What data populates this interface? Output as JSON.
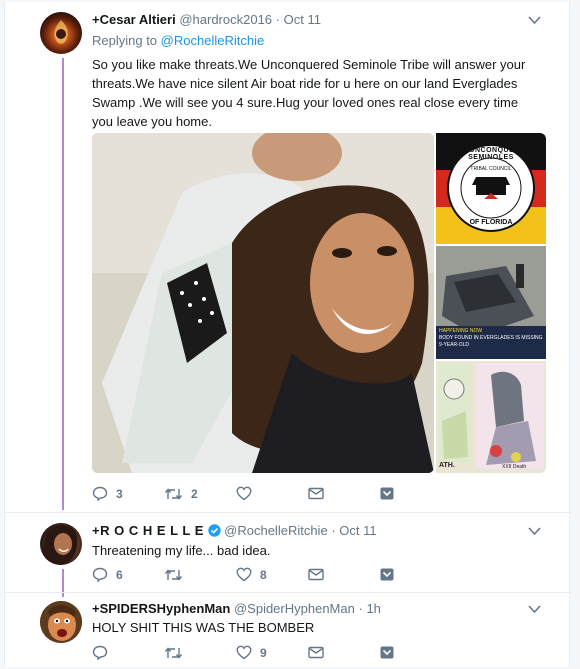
{
  "tweets": [
    {
      "name": "+Cesar Altieri",
      "handle": "@hardrock2016",
      "dot": "·",
      "time": "Oct 11",
      "replying_prefix": "Replying to",
      "replying_to": "@RochelleRitchie",
      "text": "So you like make threats.We Unconquered Seminole Tribe will answer your threats.We have nice silent Air boat ride for u here on our land Everglades Swamp .We will see you 4 sure.Hug your loved ones real close every time you leave you home.",
      "media": {
        "seal_top_text": "THE UNCONQUERED SEMINOLES",
        "seal_mid_text": "TRIBAL COUNCIL",
        "seal_bottom_text": "OF FLORIDA",
        "news_caption_1": "HAPPENING NOW",
        "news_caption_2": "BODY FOUND IN EVERGLADES IS MISSING",
        "news_caption_3": "9-YEAR-OLD",
        "collage_caption_left": "ATH.",
        "collage_caption_right": "XXII Death"
      },
      "replies": "3",
      "retweets": "2",
      "likes": ""
    },
    {
      "name": "+R O C H E L L E",
      "handle": "@RochelleRitchie",
      "dot": "·",
      "time": "Oct 11",
      "text": "Threatening my life... bad idea.",
      "replies": "6",
      "retweets": "",
      "likes": "8"
    },
    {
      "name": "+SPIDERSHyphenMan",
      "handle": "@SpiderHyphenMan",
      "dot": "·",
      "time": "1h",
      "text": "HOLY SHIT THIS WAS THE BOMBER",
      "replies": "",
      "retweets": "",
      "likes": "9"
    }
  ],
  "colors": {
    "link": "#1b95e0",
    "thread": "#b386d6",
    "muted": "#657786",
    "verified": "#1da1f2"
  },
  "icons": [
    "reply-icon",
    "retweet-icon",
    "like-icon",
    "message-icon",
    "expand-icon",
    "chevron-down-icon",
    "verified-badge-icon"
  ]
}
